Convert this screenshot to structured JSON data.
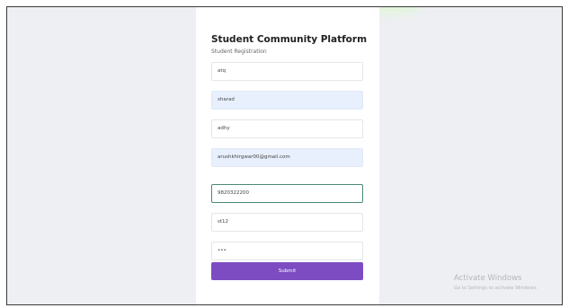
{
  "form": {
    "title": "Student Community Platform",
    "subtitle": "Student Registration",
    "fields": [
      {
        "name": "first-name",
        "value": "atq"
      },
      {
        "name": "last-name",
        "value": "sharad"
      },
      {
        "name": "username",
        "value": "adhy"
      },
      {
        "name": "email",
        "value": "arushkhirgwar00@gmail.com"
      },
      {
        "name": "phone",
        "value": "9820322200"
      },
      {
        "name": "student-id",
        "value": "st12"
      },
      {
        "name": "password",
        "value": "•••"
      }
    ],
    "submit_label": "Submit"
  },
  "watermark": {
    "title": "Activate Windows",
    "subtitle": "Go to Settings to activate Windows."
  },
  "colors": {
    "page_bg": "#eeeff3",
    "card_bg": "#ffffff",
    "autofill_bg": "#e8f0fe",
    "focus_border": "#4a8a74",
    "submit_bg": "#7d4cc2"
  }
}
